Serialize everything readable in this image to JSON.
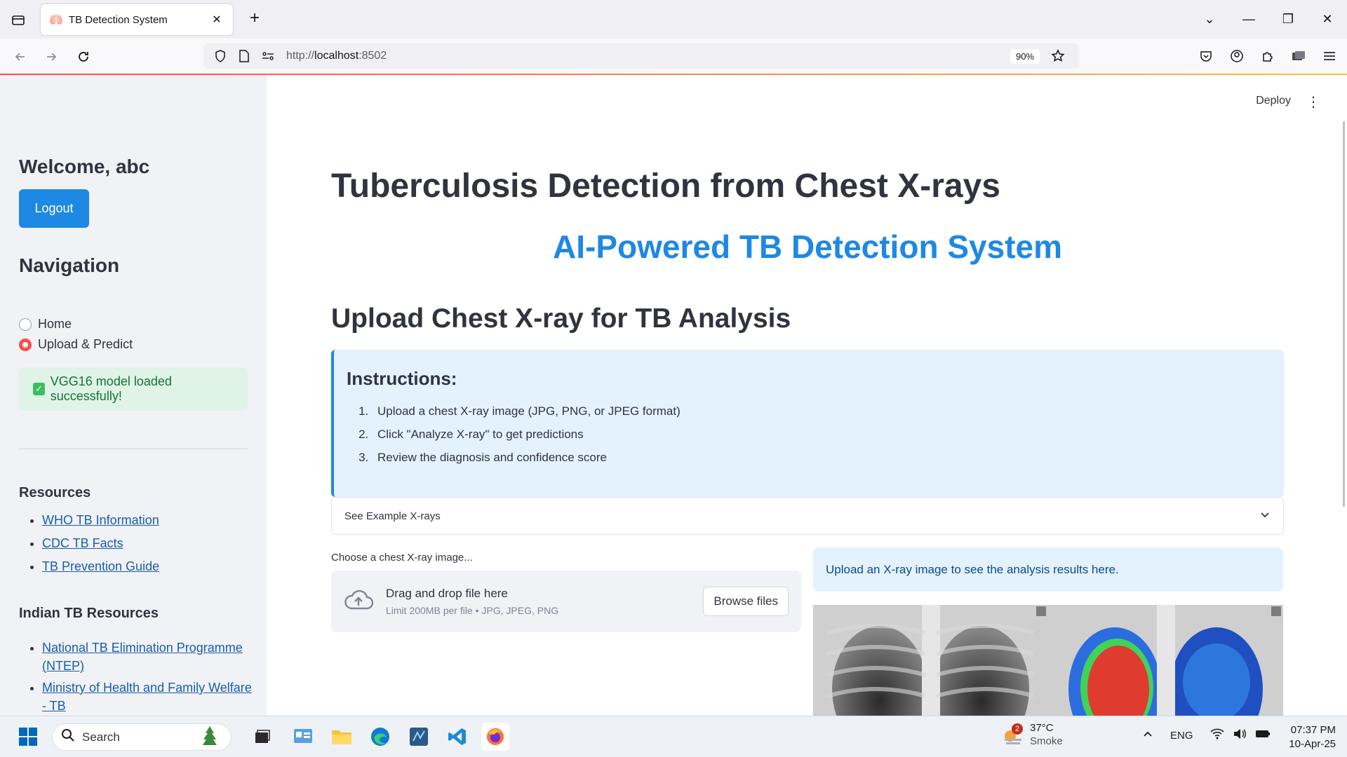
{
  "browser": {
    "tab_title": "TB Detection System",
    "url_prefix": "http://",
    "url_host": "localhost",
    "url_port": ":8502",
    "zoom": "90%"
  },
  "app": {
    "deploy_label": "Deploy",
    "sidebar": {
      "welcome": "Welcome, abc",
      "logout_label": "Logout",
      "nav_heading": "Navigation",
      "nav_options": [
        {
          "label": "Home",
          "selected": false
        },
        {
          "label": "Upload & Predict",
          "selected": true
        }
      ],
      "success_message": "VGG16 model loaded successfully!",
      "resources_heading": "Resources",
      "resources": [
        "WHO TB Information",
        "CDC TB Facts",
        "TB Prevention Guide"
      ],
      "indian_heading": "Indian TB Resources",
      "indian_resources": [
        "National TB Elimination Programme (NTEP)",
        "Ministry of Health and Family Welfare - TB"
      ]
    },
    "main": {
      "title": "Tuberculosis Detection from Chest X-rays",
      "subtitle": "AI-Powered TB Detection System",
      "section_heading": "Upload Chest X-ray for TB Analysis",
      "instructions_heading": "Instructions:",
      "instructions": [
        "Upload a chest X-ray image (JPG, PNG, or JPEG format)",
        "Click \"Analyze X-ray\" to get predictions",
        "Review the diagnosis and confidence score"
      ],
      "expander_label": "See Example X-rays",
      "upload_label": "Choose a chest X-ray image...",
      "drop_title": "Drag and drop file here",
      "drop_limit": "Limit 200MB per file • JPG, JPEG, PNG",
      "browse_label": "Browse files",
      "result_placeholder": "Upload an X-ray image to see the analysis results here."
    }
  },
  "taskbar": {
    "search_label": "Search",
    "weather_badge": "2",
    "temperature": "37°C",
    "condition": "Smoke",
    "language": "ENG",
    "time": "07:37 PM",
    "date": "10-Apr-25"
  },
  "colors": {
    "accent_blue": "#1e88e5",
    "radio_selected": "#ff4b4b",
    "sidebar_bg": "#f0f2f6",
    "info_bg": "#e3f2fd",
    "success_bg": "#dff3e7"
  }
}
